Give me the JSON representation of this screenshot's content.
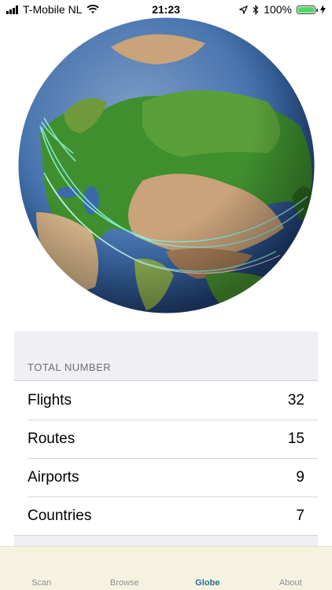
{
  "status_bar": {
    "carrier": "T-Mobile NL",
    "time": "21:23",
    "battery": "100%",
    "battery_level": 1.0
  },
  "globe": {
    "ocean_color": "#3b6aa8",
    "land_green": "#3f8f2e",
    "land_tan": "#c9a37a",
    "route_color": "#8ff0e0"
  },
  "stats": {
    "section_title": "TOTAL NUMBER",
    "rows": [
      {
        "label": "Flights",
        "value": "32"
      },
      {
        "label": "Routes",
        "value": "15"
      },
      {
        "label": "Airports",
        "value": "9"
      },
      {
        "label": "Countries",
        "value": "7"
      }
    ]
  },
  "tabs": [
    {
      "label": "Scan",
      "active": false
    },
    {
      "label": "Browse",
      "active": false
    },
    {
      "label": "Globe",
      "active": true
    },
    {
      "label": "About",
      "active": false
    }
  ]
}
